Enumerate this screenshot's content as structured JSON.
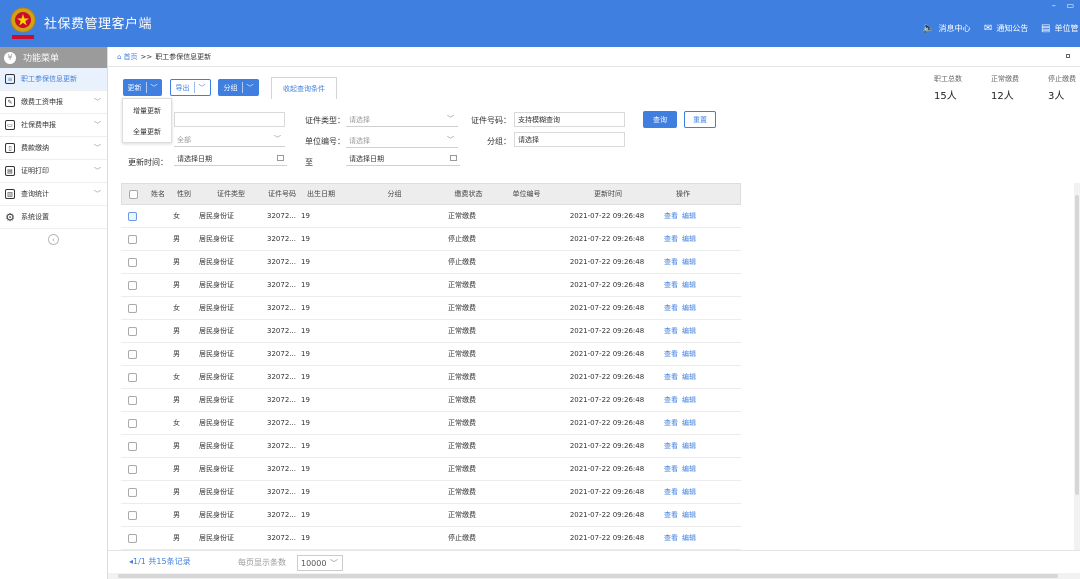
{
  "header": {
    "title": "社保费管理客户端",
    "window_controls": [
      "–",
      "▭"
    ],
    "nav": [
      {
        "label": "消息中心",
        "icon": "speaker-icon"
      },
      {
        "label": "通知公告",
        "icon": "mail-icon"
      },
      {
        "label": "单位管",
        "icon": "building-icon"
      }
    ]
  },
  "sidebar": {
    "title": "功能菜单",
    "items": [
      {
        "label": "职工参保信息更新",
        "icon": "list-icon",
        "active": true
      },
      {
        "label": "缴费工资申报",
        "icon": "edit-icon"
      },
      {
        "label": "社保费申报",
        "icon": "form-icon"
      },
      {
        "label": "费款缴纳",
        "icon": "payment-icon"
      },
      {
        "label": "证明打印",
        "icon": "print-icon"
      },
      {
        "label": "查询统计",
        "icon": "chart-icon"
      },
      {
        "label": "系统设置",
        "icon": "gear-icon"
      }
    ]
  },
  "breadcrumb": {
    "home": "首页",
    "sep": ">>",
    "current": "职工参保信息更新"
  },
  "toolbar": {
    "update": "更新",
    "export": "导出",
    "group": "分组",
    "collapse": "收起查询条件",
    "dropdown": [
      "增量更新",
      "全量更新"
    ]
  },
  "stats": [
    {
      "label": "职工总数",
      "value": "15人"
    },
    {
      "label": "正常缴费",
      "value": "12人"
    },
    {
      "label": "停止缴费",
      "value": "3人"
    }
  ],
  "filters": {
    "status_value": "全部",
    "id_type_label": "证件类型：",
    "id_type_placeholder": "请选择",
    "id_no_label": "证件号码：",
    "id_no_placeholder": "支持模糊查询",
    "unit_no_label": "单位编号：",
    "unit_no_placeholder": "请选择",
    "group_label": "分组：",
    "group_placeholder": "请选择",
    "update_time_label": "更新时间：",
    "date_from_placeholder": "请选择日期",
    "to_label": "至",
    "date_to_placeholder": "请选择日期",
    "query": "查询",
    "reset": "重置"
  },
  "table": {
    "columns": [
      "姓名",
      "性别",
      "证件类型",
      "证件号码",
      "出生日期",
      "分组",
      "缴费状态",
      "单位编号",
      "更新时间",
      "操作"
    ],
    "view": "查看",
    "edit": "编辑",
    "rows": [
      {
        "gender": "女",
        "id_type": "居民身份证",
        "id_no": "32072...",
        "birth": "19",
        "status": "正常缴费",
        "time": "2021-07-22 09:26:48"
      },
      {
        "gender": "男",
        "id_type": "居民身份证",
        "id_no": "32072...",
        "birth": "19",
        "status": "停止缴费",
        "time": "2021-07-22 09:26:48"
      },
      {
        "gender": "男",
        "id_type": "居民身份证",
        "id_no": "32072...",
        "birth": "19",
        "status": "停止缴费",
        "time": "2021-07-22 09:26:48"
      },
      {
        "gender": "男",
        "id_type": "居民身份证",
        "id_no": "32072...",
        "birth": "19",
        "status": "正常缴费",
        "time": "2021-07-22 09:26:48"
      },
      {
        "gender": "女",
        "id_type": "居民身份证",
        "id_no": "32072...",
        "birth": "19",
        "status": "正常缴费",
        "time": "2021-07-22 09:26:48"
      },
      {
        "gender": "男",
        "id_type": "居民身份证",
        "id_no": "32072...",
        "birth": "19",
        "status": "正常缴费",
        "time": "2021-07-22 09:26:48"
      },
      {
        "gender": "男",
        "id_type": "居民身份证",
        "id_no": "32072...",
        "birth": "19",
        "status": "正常缴费",
        "time": "2021-07-22 09:26:48"
      },
      {
        "gender": "女",
        "id_type": "居民身份证",
        "id_no": "32072...",
        "birth": "19",
        "status": "正常缴费",
        "time": "2021-07-22 09:26:48"
      },
      {
        "gender": "男",
        "id_type": "居民身份证",
        "id_no": "32072...",
        "birth": "19",
        "status": "正常缴费",
        "time": "2021-07-22 09:26:48"
      },
      {
        "gender": "女",
        "id_type": "居民身份证",
        "id_no": "32072...",
        "birth": "19",
        "status": "正常缴费",
        "time": "2021-07-22 09:26:48"
      },
      {
        "gender": "男",
        "id_type": "居民身份证",
        "id_no": "32072...",
        "birth": "19",
        "status": "正常缴费",
        "time": "2021-07-22 09:26:48"
      },
      {
        "gender": "男",
        "id_type": "居民身份证",
        "id_no": "32072...",
        "birth": "19",
        "status": "正常缴费",
        "time": "2021-07-22 09:26:48"
      },
      {
        "gender": "男",
        "id_type": "居民身份证",
        "id_no": "32072...",
        "birth": "19",
        "status": "正常缴费",
        "time": "2021-07-22 09:26:48"
      },
      {
        "gender": "男",
        "id_type": "居民身份证",
        "id_no": "32072...",
        "birth": "19",
        "status": "正常缴费",
        "time": "2021-07-22 09:26:48"
      },
      {
        "gender": "男",
        "id_type": "居民身份证",
        "id_no": "32072...",
        "birth": "19",
        "status": "停止缴费",
        "time": "2021-07-22 09:26:48"
      }
    ]
  },
  "pager": {
    "info": "1/1 共15条记录",
    "size_label": "每页显示条数",
    "size": "10000"
  },
  "colors": {
    "primary": "#3f7fe0",
    "sidebar_head": "#9b9b9b"
  }
}
